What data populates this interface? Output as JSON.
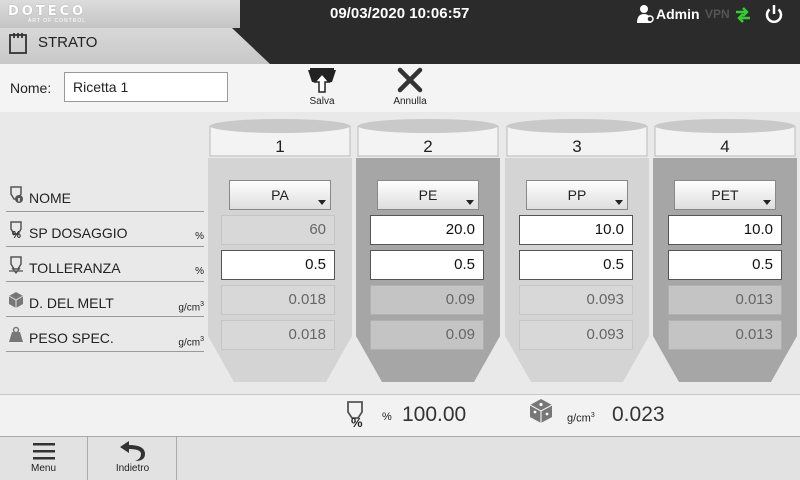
{
  "topbar": {
    "logo": "DOTECO",
    "logo_sub": "ART OF CONTROL",
    "datetime": "09/03/2020 10:06:57",
    "user": "Admin",
    "vpn": "VPN"
  },
  "header": {
    "title": "STRATO"
  },
  "recipe": {
    "name_label": "Nome:",
    "name_value": "Ricetta 1"
  },
  "toolbar": {
    "save_label": "Salva",
    "cancel_label": "Annulla"
  },
  "rows": {
    "nome": {
      "label": "NOME",
      "unit": ""
    },
    "dosaggio": {
      "label": "SP DOSAGGIO",
      "unit": "%"
    },
    "tolleranza": {
      "label": "TOLLERANZA",
      "unit": "%"
    },
    "melt": {
      "label": "D. DEL MELT",
      "unit": "g/cm",
      "unit_sup": "3"
    },
    "peso": {
      "label": "PESO SPEC.",
      "unit": "g/cm",
      "unit_sup": "3"
    }
  },
  "hoppers": [
    {
      "number": "1",
      "material": "PA",
      "dosaggio": "60",
      "tolleranza": "0.5",
      "melt": "0.018",
      "peso": "0.018"
    },
    {
      "number": "2",
      "material": "PE",
      "dosaggio": "20.0",
      "tolleranza": "0.5",
      "melt": "0.09",
      "peso": "0.09"
    },
    {
      "number": "3",
      "material": "PP",
      "dosaggio": "10.0",
      "tolleranza": "0.5",
      "melt": "0.093",
      "peso": "0.093"
    },
    {
      "number": "4",
      "material": "PET",
      "dosaggio": "10.0",
      "tolleranza": "0.5",
      "melt": "0.013",
      "peso": "0.013"
    }
  ],
  "totals": {
    "pct_unit": "%",
    "pct_value": "100.00",
    "density_unit": "g/cm",
    "density_unit_sup": "3",
    "density_value": "0.023"
  },
  "bottombar": {
    "menu_label": "Menu",
    "back_label": "Indietro"
  },
  "colors": {
    "topbar": "#2b2b2b",
    "hopper_light": "#d4d4d4",
    "hopper_dark": "#a6a6a6",
    "sync_icon": "#33cc33"
  }
}
